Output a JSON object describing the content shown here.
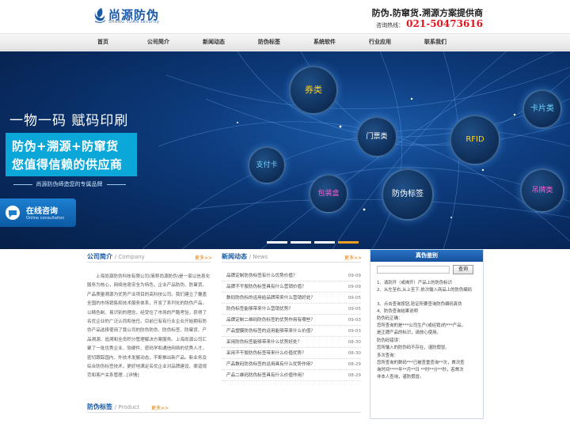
{
  "header": {
    "logo_name": "尚源防伪",
    "logo_sub": "SHANG YUAN security",
    "slogan": "防伪.防窜货.溯源方案提供商",
    "hotline_label": "咨询热线：",
    "hotline_number": "021-50473616"
  },
  "nav": {
    "items": [
      {
        "label": "首页"
      },
      {
        "label": "公司简介"
      },
      {
        "label": "新闻动态"
      },
      {
        "label": "防伪标签"
      },
      {
        "label": "系统软件"
      },
      {
        "label": "行业应用"
      },
      {
        "label": "联系我们"
      }
    ]
  },
  "banner": {
    "title": "一物一码 赋码印刷",
    "box_line1": "防伪+溯源+防窜货",
    "box_line2": "您值得信赖的供应商",
    "tagline": "尚源防伪缔造您的专属品牌",
    "consult_title": "在线咨询",
    "consult_sub": "Online consultation",
    "bubbles": [
      {
        "label": "券类",
        "color": "#ffd21e"
      },
      {
        "label": "门票类",
        "color": "#ffffff"
      },
      {
        "label": "RFID",
        "color": "#ffd21e"
      },
      {
        "label": "卡片类",
        "color": "#6fd3ff"
      },
      {
        "label": "支付卡",
        "color": "#6fd3ff"
      },
      {
        "label": "包装盒",
        "color": "#ff5fd0"
      },
      {
        "label": "防伪标签",
        "color": "#ffffff"
      },
      {
        "label": "吊牌类",
        "color": "#ff5fd0"
      }
    ],
    "active_slide": 4,
    "slide_count": 4
  },
  "about": {
    "title": "公司简介",
    "title_en": "/ Company",
    "more": "更多>>",
    "text": "上海尚源防伪科技有限公司(简称尚源防伪)是一家以信息化服务为核心，网络信息安全为特色，企业产品防伪、防窜货、产品质量溯源为优势产业项目的高科技公司。我们建立了覆盖全国的市场销售和技术服务体系，开发了系列化的防伪产品，以精色制、易识别的理念，经受住了市场的严酷考验，获得了名优企业的广泛认同和信任。目前已有有行业企业开始拥有防伪产品选择使用了我公司的防伪防伪、防伪标签、防窜货、产品溯源、追溯和全员积分管理解决方案服务。上海尚源公司汇聚了一批优秀企业、软硬件、密码学和通信网络的优秀人才，密切跟踪国内、外技术发展动态，不断推出新产品。新业务及综合防伪标签技术，更好地满足名优企业对品牌建设、渠道规范和客户关系管理...[详情]"
  },
  "news": {
    "title": "新闻动态",
    "title_en": "/ News",
    "more": "更多>>",
    "items": [
      {
        "title": "品牌定制防伪标签有什么优势价值？",
        "date": "09-09"
      },
      {
        "title": "品牌不干胶防伪标签具有什么营销价值？",
        "date": "09-09"
      },
      {
        "title": "数码防伪标的运用给品牌带来什么营销好处？",
        "date": "09-05"
      },
      {
        "title": "防伪标签能够带来什么营销优势？",
        "date": "09-05"
      },
      {
        "title": "品牌定制二维码防伪标签的优势作用有哪些？",
        "date": "09-03"
      },
      {
        "title": "产品塑膜防伪标签的运用能够带来什么价值？",
        "date": "09-03"
      },
      {
        "title": "采用防伪标签能够带来什么优势好处？",
        "date": "08-30"
      },
      {
        "title": "采用不干胶防伪标签带来什么价值优势？",
        "date": "08-30"
      },
      {
        "title": "产品数码防伪标签的运用具有什么优势作用？",
        "date": "08-29"
      },
      {
        "title": "产品二维码防伪标签具有什么价值作用？",
        "date": "08-29"
      }
    ]
  },
  "verify": {
    "title": "真伪鉴别",
    "button": "查询",
    "lines": [
      "1、请刮开（或揭开）产品上的防伪标识",
      "2、从左至右,从上至下,依次输入商品上的防伪编码",
      "3、点击查询按钮,验证所要查询防伪编码真伪",
      "4、防伪查询结果说明",
      "防伪码正确：",
      "您所查询的是***公司生产(或经销)的***产品，",
      "是正牌产品的标识，请放心使用。",
      "防伪码错误：",
      "您所输入的防伪码不存在，谨防假冒。",
      "多次查询：",
      "您所查询的数码***已被查重查询**次，首次查",
      "询时间****年**月**日 **时**分**秒，若首次",
      "非本人查询，谨防假冒。"
    ]
  },
  "product": {
    "title": "防伪标签",
    "title_en": "/ Product",
    "more": "更多>>"
  },
  "colors": {
    "brand_blue": "#1a5aa6",
    "hotline_red": "#e0141e",
    "more_orange": "#e07b00",
    "banner_dark": "#082a5e",
    "box_cyan": "#0aa7d8"
  }
}
